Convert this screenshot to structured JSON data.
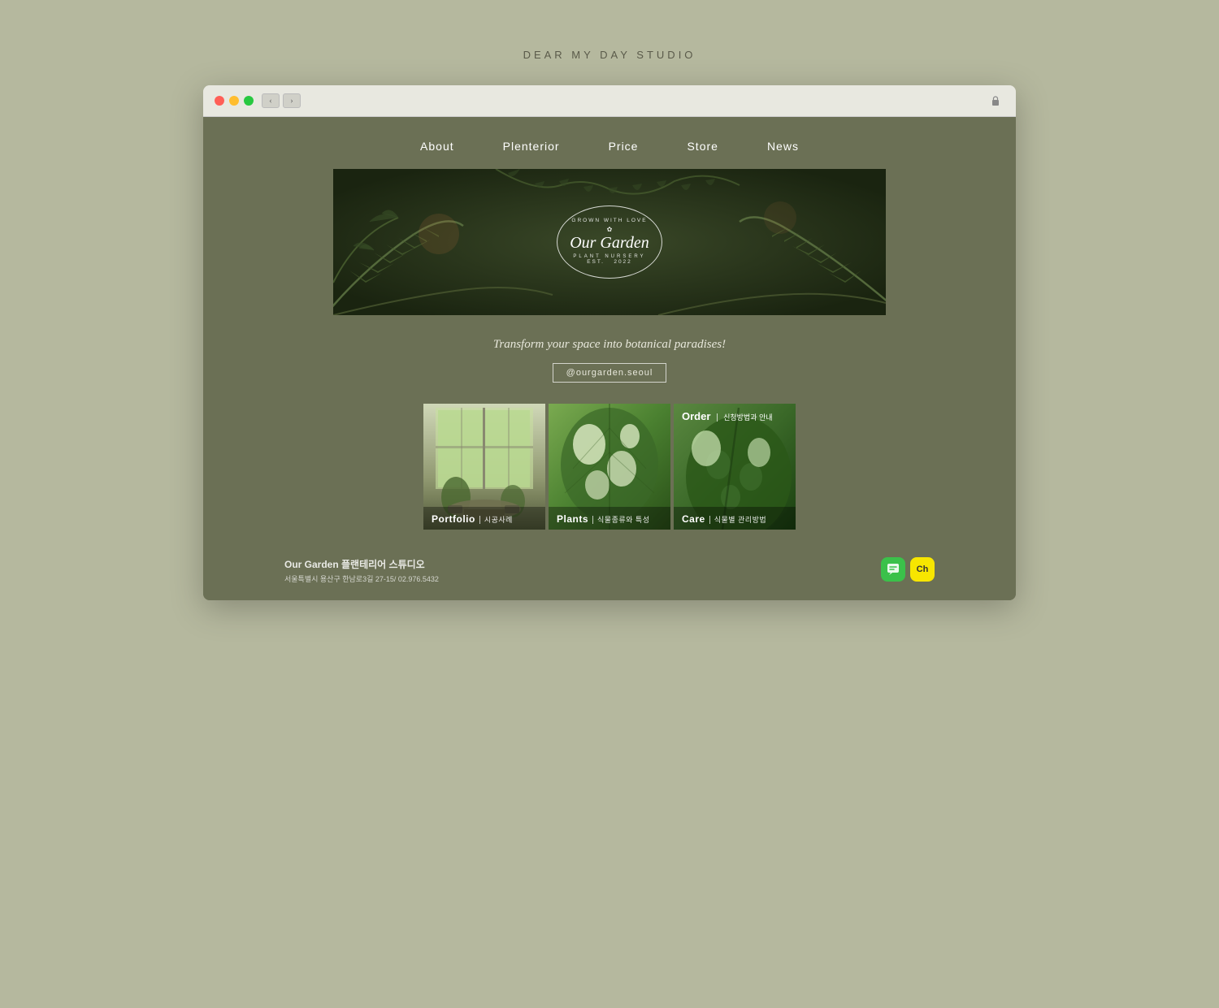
{
  "studio": {
    "name": "DEAR MY DAY STUDIO"
  },
  "browser": {
    "back_btn": "‹",
    "forward_btn": "›",
    "lock_icon": "🔒"
  },
  "nav": {
    "items": [
      {
        "label": "About"
      },
      {
        "label": "Plenterior"
      },
      {
        "label": "Price"
      },
      {
        "label": "Store"
      },
      {
        "label": "News"
      }
    ]
  },
  "hero": {
    "logo_grown": "GROWN WITH LOVE",
    "logo_main": "Our Garden",
    "logo_nursery": "PLANT NURSERY",
    "logo_est": "EST.",
    "logo_year": "2022"
  },
  "tagline": {
    "text": "Transform your space into botanical paradises!",
    "instagram": "@ourgarden.seoul"
  },
  "cards": [
    {
      "label_en": "Portfolio",
      "separator": "|",
      "label_ko": "시공사례",
      "type": "portfolio"
    },
    {
      "label_en": "Plants",
      "separator": "|",
      "label_ko": "식물종류와 특성",
      "type": "plants"
    },
    {
      "order_en": "Order",
      "order_separator": "|",
      "order_ko": "신청방법과 안내",
      "label_en": "Care",
      "separator": "|",
      "label_ko": "식물별 관리방법",
      "type": "care"
    }
  ],
  "footer": {
    "company": "Our Garden 플랜테리어 스튜디오",
    "address": "서울특별시 용산구 한남로3길 27-15/ 02.976.5432",
    "chat_icon1": "💬",
    "chat_icon2": "Ch"
  }
}
